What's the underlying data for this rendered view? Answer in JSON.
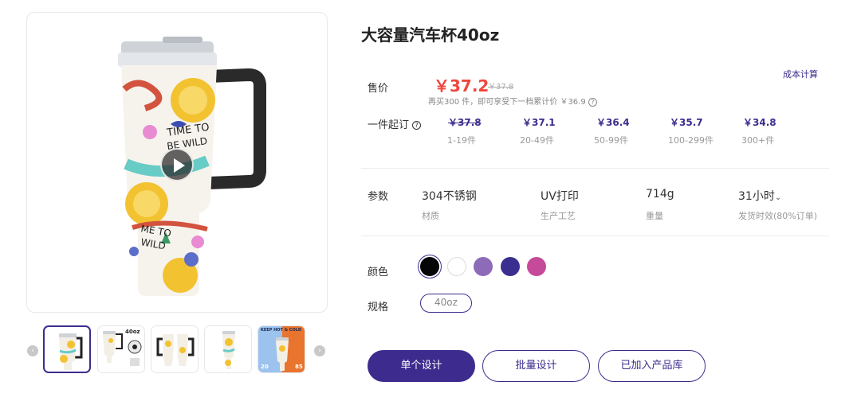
{
  "product": {
    "title": "大容量汽车杯40oz"
  },
  "price": {
    "label": "售价",
    "current": "￥37.2",
    "original": "￥37.8",
    "hint": "再买300 件，即可享受下一档累计价 ￥36.9",
    "cost_link": "成本计算"
  },
  "tiers": {
    "label": "一件起订",
    "items": [
      {
        "price": "￥37.8",
        "qty": "1-19件",
        "struck": true
      },
      {
        "price": "￥37.1",
        "qty": "20-49件",
        "struck": false
      },
      {
        "price": "￥36.4",
        "qty": "50-99件",
        "struck": false
      },
      {
        "price": "￥35.7",
        "qty": "100-299件",
        "struck": false
      },
      {
        "price": "￥34.8",
        "qty": "300+件",
        "struck": false
      }
    ]
  },
  "params": {
    "label": "参数",
    "items": [
      {
        "value": "304不锈钢",
        "key": "材质"
      },
      {
        "value": "UV打印",
        "key": "生产工艺"
      },
      {
        "value": "714g",
        "key": "重量"
      },
      {
        "value": "31小时",
        "key": "发货时效(80%订单)"
      }
    ]
  },
  "colors": {
    "label": "颜色",
    "swatches": [
      "#050505",
      "#ffffff",
      "#8d6bb8",
      "#3a2f8f",
      "#c64a9a"
    ],
    "selected_index": 0
  },
  "spec": {
    "label": "规格",
    "option": "40oz"
  },
  "gallery": {
    "thumb2_caption": "40oz",
    "thumb5_banner": "KEEP HOT & COLD",
    "thumb5_left": "20",
    "thumb5_right": "85",
    "active_index": 0
  },
  "actions": {
    "single_design": "单个设计",
    "batch_design": "批量设计",
    "added_to_library": "已加入产品库"
  },
  "theme": {
    "accent": "#3d2c8d",
    "price_red": "#f0463c"
  }
}
